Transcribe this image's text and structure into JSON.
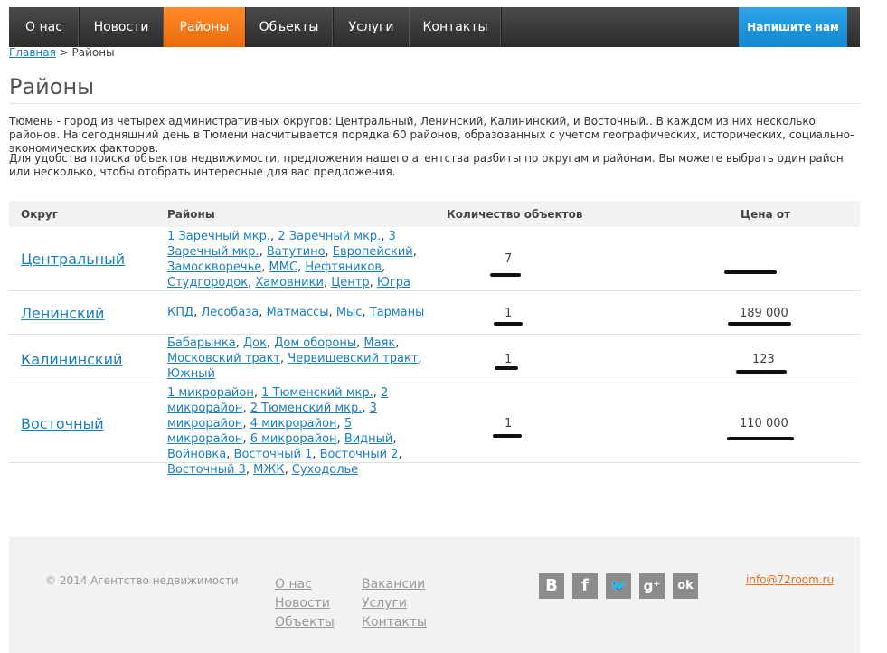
{
  "nav": {
    "items": [
      {
        "label": "О нас"
      },
      {
        "label": "Новости"
      },
      {
        "label": "Районы"
      },
      {
        "label": "Объекты"
      },
      {
        "label": "Услуги"
      },
      {
        "label": "Контакты"
      }
    ],
    "active_index": 2,
    "cta_label": "Напишите нам"
  },
  "breadcrumb": {
    "home": "Главная",
    "sep": " > ",
    "current": "Районы"
  },
  "page_title": "Районы",
  "intro": [
    "Тюмень - город из четырех административных округов: Центральный, Ленинский, Калининский, и Восточный.. В каждом из них несколько районов. На сегодняшний день в Тюмени насчитывается порядка 60 районов, образованных с учетом географических, исторических, социально-экономических факторов.",
    "Для удобства поиска объектов недвижимости, предложения нашего агентства разбиты по округам и районам. Вы можете выбрать один район или несколько, чтобы отобрать интересные для вас предложения."
  ],
  "table": {
    "headers": {
      "okrug": "Округ",
      "districts": "Районы",
      "count": "Количество объектов",
      "price": "Цена от"
    },
    "rows": [
      {
        "okrug": "Центральный",
        "districts": [
          "1 Заречный мкр.",
          "2 Заречный мкр.",
          "3 Заречный мкр.",
          "Ватутино",
          "Европейский",
          "Замоскворечье",
          "ММС",
          "Нефтяников",
          "Студгородок",
          "Хамовники",
          "Центр",
          "Югра"
        ],
        "count": "7",
        "price": ""
      },
      {
        "okrug": "Ленинский",
        "districts": [
          "КПД",
          "Лесобаза",
          "Матмассы",
          "Мыс",
          "Тарманы"
        ],
        "count": "1",
        "price": "189 000"
      },
      {
        "okrug": "Калининский",
        "districts": [
          "Бабарынка",
          "Док",
          "Дом обороны",
          "Маяк",
          "Московский тракт",
          "Червишевский тракт",
          "Южный"
        ],
        "count": "1",
        "price": "123"
      },
      {
        "okrug": "Восточный",
        "districts": [
          "1 микрорайон",
          "1 Тюменский мкр.",
          "2 микрорайон",
          "2 Тюменский мкр.",
          "3 микрорайон",
          "4 микрорайон",
          "5 микрорайон",
          "6 микрорайон",
          "Видный",
          "Войновка",
          "Восточный 1",
          "Восточный 2",
          "Восточный 3",
          "МЖК",
          "Суходолье"
        ],
        "count": "1",
        "price": "110 000"
      }
    ]
  },
  "footer": {
    "copyright": "© 2014 Агентство недвижимости",
    "links_col1": [
      "О нас",
      "Новости",
      "Объекты"
    ],
    "links_col2": [
      "Вакансии",
      "Услуги",
      "Контакты"
    ],
    "social": [
      {
        "name": "vk-icon",
        "glyph": "B"
      },
      {
        "name": "facebook-icon",
        "glyph": "f"
      },
      {
        "name": "twitter-icon",
        "glyph": "🐦"
      },
      {
        "name": "google-plus-icon",
        "glyph": "g⁺"
      },
      {
        "name": "odnoklassniki-icon",
        "glyph": "ok"
      }
    ],
    "email": "info@72room.ru"
  },
  "colors": {
    "accent": "#ea6b08",
    "link": "#1a7fc2",
    "cta": "#1488d1"
  }
}
